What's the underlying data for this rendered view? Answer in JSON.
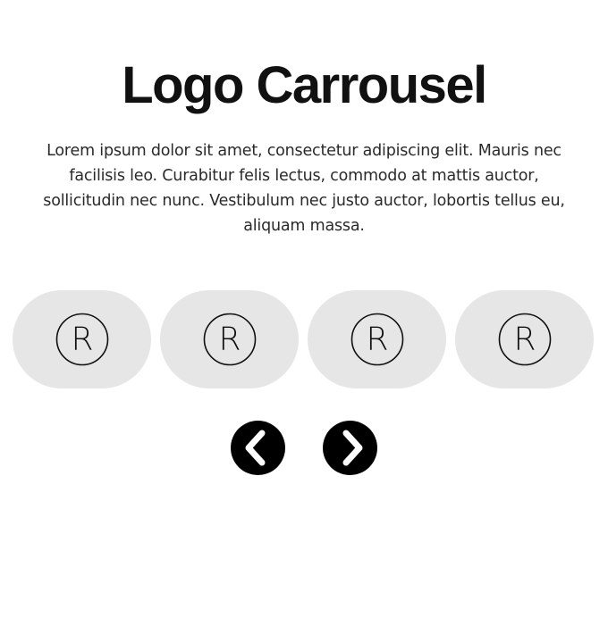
{
  "header": {
    "title": "Logo Carrousel",
    "description": "Lorem ipsum dolor sit amet, consectetur adipiscing elit. Mauris nec facilisis leo. Curabitur felis lectus, commodo at mattis auctor, sollicitudin nec nunc. Vestibulum nec justo auctor, lobortis tellus eu, aliquam massa."
  },
  "carousel": {
    "logos": [
      {
        "icon": "registered-icon",
        "glyph": "R"
      },
      {
        "icon": "registered-icon",
        "glyph": "R"
      },
      {
        "icon": "registered-icon",
        "glyph": "R"
      },
      {
        "icon": "registered-icon",
        "glyph": "R"
      }
    ]
  },
  "navigation": {
    "prev_icon": "chevron-left-icon",
    "next_icon": "chevron-right-icon"
  },
  "colors": {
    "card_background": "#e6e6e6",
    "button_background": "#000000",
    "button_icon": "#ffffff",
    "text": "#111111"
  }
}
